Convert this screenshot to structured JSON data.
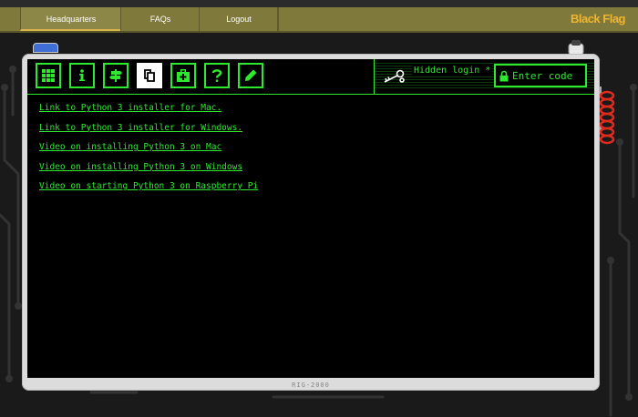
{
  "nav": {
    "items": [
      {
        "label": "Headquarters",
        "active": true
      },
      {
        "label": "FAQs",
        "active": false
      },
      {
        "label": "Logout",
        "active": false
      }
    ],
    "brand": "Black Flag"
  },
  "colors": {
    "nav_bg": "#7f7a3c",
    "brand": "#f0b530",
    "terminal_green": "#2ee830",
    "screen_bg": "#000000",
    "device_bg": "#dcdcdc"
  },
  "toolbar": {
    "buttons": [
      {
        "icon": "grid-icon",
        "active": false
      },
      {
        "icon": "info-icon",
        "active": false
      },
      {
        "icon": "signpost-icon",
        "active": false
      },
      {
        "icon": "documents-icon",
        "active": true
      },
      {
        "icon": "first-aid-kit-icon",
        "active": false
      },
      {
        "icon": "question-icon",
        "active": false
      },
      {
        "icon": "pencil-icon",
        "active": false
      }
    ]
  },
  "login": {
    "label": "Hidden login *",
    "placeholder": "Enter code"
  },
  "links": [
    "Link to Python 3 installer for Mac.",
    "Link to Python 3 installer for Windows.",
    "Video on installing Python 3 on Mac",
    "Video on installing Python 3 on Windows",
    "Video on starting Python 3 on Raspberry Pi"
  ],
  "device": {
    "label": "RIG-2000"
  }
}
